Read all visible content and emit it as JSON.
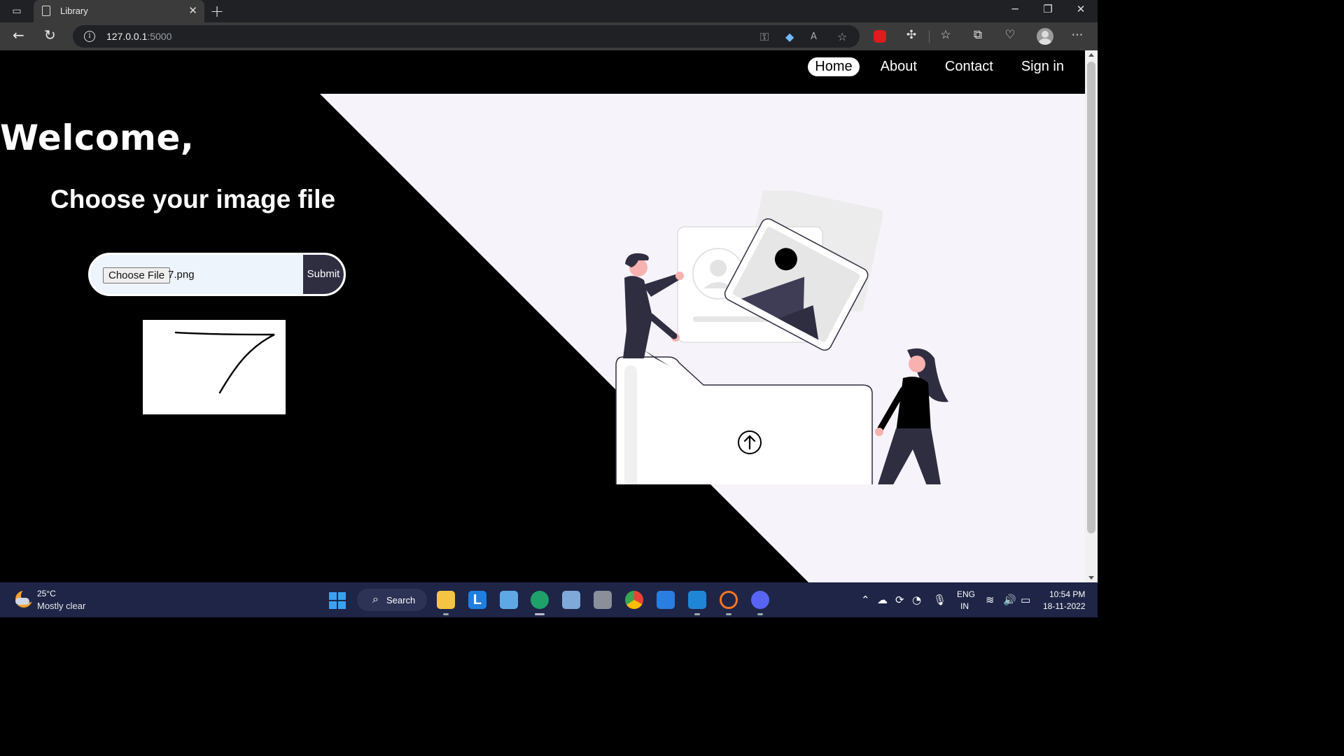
{
  "browser": {
    "tab_title": "Library",
    "tab_close": "✕",
    "new_tab": "+",
    "url_host": "127.0.0.1",
    "url_port": ":5000",
    "window_controls": {
      "minimize": "─",
      "restore": "❐",
      "close": "✕"
    },
    "toolbar_icons": [
      "key-icon",
      "coupon-icon",
      "read-aloud-icon",
      "add-favorite-icon",
      "adblock-icon",
      "extensions-icon",
      "favorites-icon",
      "collections-icon",
      "health-icon",
      "profile-icon",
      "more-icon"
    ]
  },
  "nav": {
    "items": [
      {
        "label": "Home",
        "active": true
      },
      {
        "label": "About",
        "active": false
      },
      {
        "label": "Contact",
        "active": false
      },
      {
        "label": "Sign in",
        "active": false
      }
    ]
  },
  "hero": {
    "welcome": "Welcome,",
    "title": "Choose your image file"
  },
  "upload": {
    "choose_label": "Choose File",
    "file_name": "7.png",
    "submit_label": "Submit"
  },
  "preview": {
    "digit": "7"
  },
  "colors": {
    "accent": "#2f2e41",
    "light_panel": "#f7f3fa",
    "pill_bg": "#eef4fc"
  },
  "taskbar": {
    "weather_temp": "25°C",
    "weather_cond": "Mostly clear",
    "search_label": "Search",
    "apps": [
      "file-explorer-icon",
      "l-app-icon",
      "control-panel-icon",
      "edge-icon",
      "photos-icon",
      "calculator-icon",
      "chrome-icon",
      "connect-icon",
      "vscode-icon",
      "jupyter-icon",
      "discord-icon"
    ],
    "lang_line1": "ENG",
    "lang_line2": "IN",
    "time": "10:54 PM",
    "date": "18-11-2022"
  }
}
